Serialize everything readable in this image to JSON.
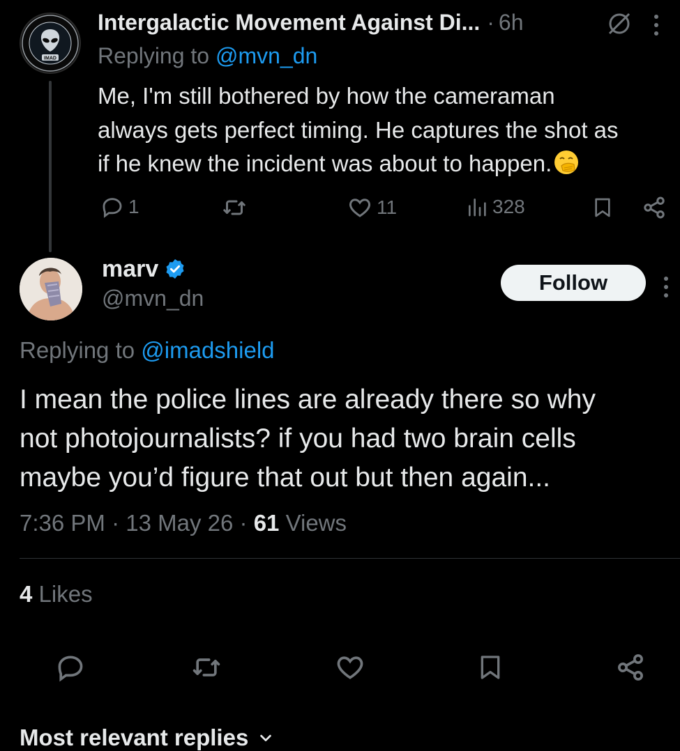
{
  "parent_tweet": {
    "author_name": "Intergalactic Movement Against Di...",
    "time": "6h",
    "replying_prefix": "Replying to ",
    "replying_handle": "@mvn_dn",
    "avatar_badge": "IMAD",
    "text_lines": [
      "Me, I'm still bothered by how the cameraman",
      "always gets perfect timing. He captures the shot as",
      "if he knew the incident was about to happen."
    ],
    "emoji": "hand-over-mouth-face",
    "reply_count": "1",
    "retweet_count": "",
    "like_count": "11",
    "view_count": "328"
  },
  "main_tweet": {
    "author_name": "marv",
    "verified": true,
    "handle": "@mvn_dn",
    "follow_label": "Follow",
    "replying_prefix": "Replying to ",
    "replying_handle": "@imadshield",
    "text_lines": [
      "I mean the police lines are already there so why",
      "not photojournalists? if you had two brain cells",
      "maybe you’d figure that out but then again..."
    ],
    "time": "7:36 PM",
    "date": "13 May 26",
    "views_count": "61",
    "views_label": "Views",
    "likes_count": "4",
    "likes_label": "Likes"
  },
  "sort": {
    "label": "Most relevant replies"
  },
  "icons": {
    "reply": "reply-icon",
    "retweet": "retweet-icon",
    "like": "heart-icon",
    "views": "views-icon",
    "bookmark": "bookmark-icon",
    "share": "share-icon",
    "more": "more-vertical-icon",
    "verified": "verified-badge-icon",
    "no_entry": "no-entry-icon",
    "chevron": "chevron-down-icon"
  },
  "colors": {
    "background": "#000000",
    "text_primary": "#e7e9ea",
    "text_secondary": "#71767b",
    "accent": "#1d9bf0",
    "follow_button_bg": "#eff3f4"
  }
}
